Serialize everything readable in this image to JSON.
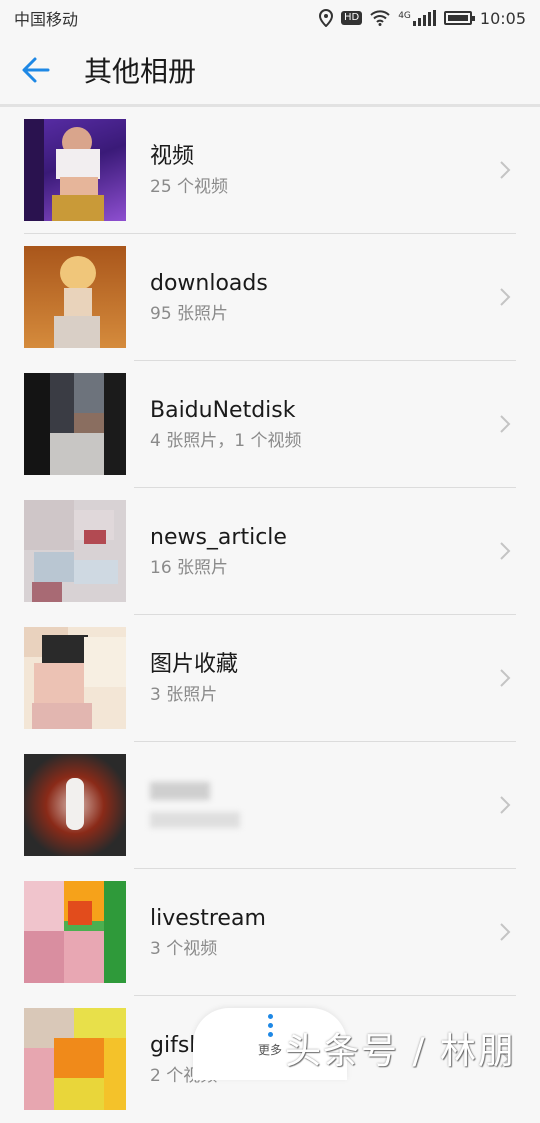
{
  "status_bar": {
    "carrier": "中国移动",
    "hd_badge": "HD",
    "network": "4G",
    "time": "10:05"
  },
  "header": {
    "title": "其他相册",
    "back_icon": "arrow-left-icon"
  },
  "colors": {
    "accent": "#1e88e5",
    "subtext": "#8a8a8a"
  },
  "albums": [
    {
      "title": "视频",
      "subtitle": "25 个视频"
    },
    {
      "title": "downloads",
      "subtitle": "95 张照片"
    },
    {
      "title": "BaiduNetdisk",
      "subtitle": "4 张照片，1 个视频"
    },
    {
      "title": "news_article",
      "subtitle": "16 张照片"
    },
    {
      "title": "图片收藏",
      "subtitle": "3 张照片"
    },
    {
      "title": "",
      "subtitle": ""
    },
    {
      "title": "livestream",
      "subtitle": "3 个视频"
    },
    {
      "title": "gifshow",
      "subtitle": "2 个视频"
    }
  ],
  "bottom": {
    "more_label": "更多",
    "watermark": "头条号 / 林朋"
  }
}
